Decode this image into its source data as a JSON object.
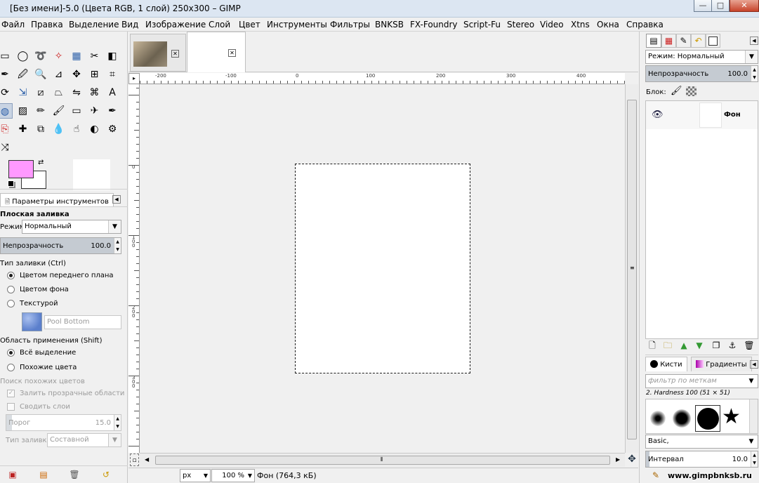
{
  "window": {
    "title": "[Без имени]-5.0 (Цвета RGB, 1 слой) 250x300 – GIMP",
    "btn_min": "—",
    "btn_max": "□",
    "btn_close": "✕"
  },
  "menu": [
    "Файл",
    "Правка",
    "Выделение",
    "Вид",
    "Изображение",
    "Слой",
    "Цвет",
    "Инструменты",
    "Фильтры",
    "BNKSB",
    "FX-Foundry",
    "Script-Fu",
    "Stereo",
    "Video",
    "Xtns",
    "Окна",
    "Справка"
  ],
  "toolbox": {
    "tools": [
      "rect-select",
      "ellipse-select",
      "free-select",
      "fuzzy-select",
      "select-by-color",
      "scissors-select",
      "foreground-select",
      "paths",
      "color-picker",
      "zoom",
      "measure",
      "move",
      "align",
      "crop",
      "rotate",
      "scale",
      "shear",
      "perspective",
      "flip",
      "cage",
      "text",
      "bucket-fill",
      "blend",
      "pencil",
      "paintbrush",
      "eraser",
      "airbrush",
      "ink",
      "clone",
      "heal",
      "perspective-clone",
      "blur",
      "smudge",
      "dodge-burn",
      "convert",
      "warp"
    ],
    "fg_color": "#ff99ff",
    "bg_color": "#ffffff",
    "options_tab_label": "Параметры инструментов",
    "tool_name": "Плоская заливка",
    "mode_label": "Режим:",
    "mode_value": "Нормальный",
    "opacity_label": "Непрозрачность",
    "opacity_value": "100.0",
    "fill_type_label": "Тип заливки  (Ctrl)",
    "fill_fg": "Цветом переднего плана",
    "fill_bg": "Цветом фона",
    "fill_pattern": "Текстурой",
    "pattern_name": "Pool Bottom",
    "area_label": "Область применения  (Shift)",
    "area_all": "Всё выделение",
    "area_similar": "Похожие цвета",
    "find_similar_label": "Поиск похожих цветов",
    "fill_transparent": "Залить прозрачные области",
    "merge_layers": "Сводить слои",
    "threshold_label": "Порог",
    "threshold_value": "15.0",
    "fill_by_label": "Тип заливки:",
    "fill_by_value": "Составной"
  },
  "image": {
    "zoom": "100 %",
    "unit": "px",
    "status": "Фон (764,3 кБ)",
    "tab_close": "✕"
  },
  "ruler_h_labels": [
    "-200",
    "-100",
    "0",
    "100",
    "200",
    "300",
    "400"
  ],
  "ruler_v_labels": [
    "0",
    "1 0 0",
    "2 0 0",
    "3 0 0"
  ],
  "layers": {
    "mode_label": "Режим: Нормальный",
    "opacity_label": "Непрозрачность",
    "opacity_value": "100.0",
    "lock_label": "Блок:",
    "layer_name": "Фон"
  },
  "brushes": {
    "tab_brushes": "Кисти",
    "tab_gradients": "Градиенты",
    "filter_placeholder": "фильтр по меткам",
    "brush_name": "2. Hardness 100 (51 × 51)",
    "preset": "Basic,",
    "spacing_label": "Интервал",
    "spacing_value": "10.0"
  },
  "watermark": "www.gimpbnksb.ru",
  "colors": {
    "accent": "#c9d4e3",
    "slider_fill": "#c5cbd2"
  }
}
